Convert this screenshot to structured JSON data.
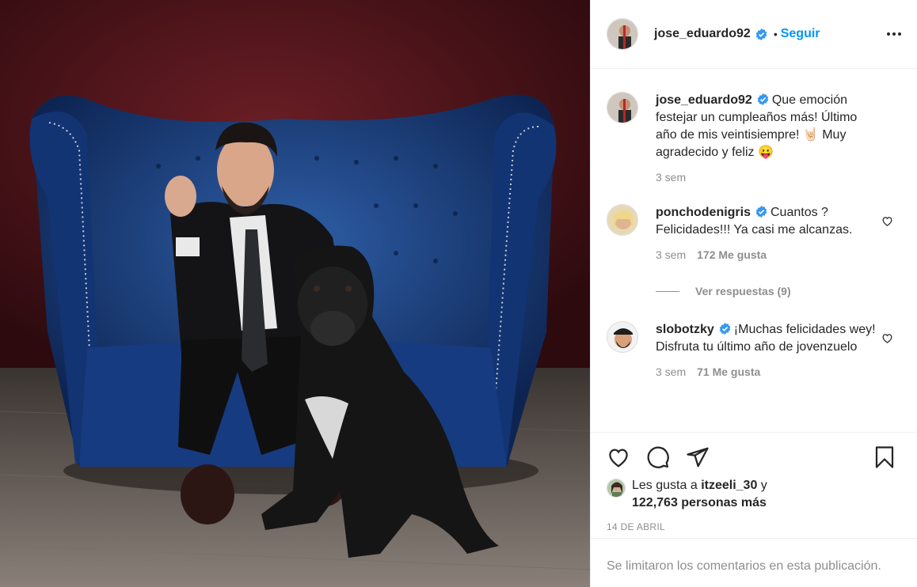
{
  "post": {
    "author": "jose_eduardo92",
    "follow_label": "Seguir",
    "dot": "•"
  },
  "caption": {
    "username": "jose_eduardo92",
    "text": "Que emoción festejar un cumpleaños más! Último año de mis veintisiempre! 🤘🏻 Muy agradecido y feliz 😛",
    "time": "3 sem"
  },
  "comments": [
    {
      "username": "ponchodenigris",
      "text": "Cuantos ? Felicidades!!! Ya casi me alcanzas.",
      "time": "3 sem",
      "likes": "172 Me gusta"
    },
    {
      "username": "slobotzky",
      "text": "¡Muchas felicidades wey! Disfruta tu último año de jovenzuelo",
      "time": "3 sem",
      "likes": "71 Me gusta"
    }
  ],
  "replies_label": "Ver respuestas (9)",
  "likes": {
    "prefix": "Les gusta a",
    "user": "itzeeli_30",
    "suffix": "y",
    "count": "122,763 personas más"
  },
  "date": "14 DE ABRIL",
  "comments_limited": "Se limitaron los comentarios en esta publicación.",
  "icons": {
    "verified": "verified-icon",
    "like": "heart-icon",
    "comment": "comment-icon",
    "share": "share-icon",
    "save": "bookmark-icon",
    "more": "more-icon"
  },
  "colors": {
    "accent": "#0095f6",
    "verified": "#3897f0",
    "text": "#262626",
    "muted": "#8e8e8e"
  }
}
